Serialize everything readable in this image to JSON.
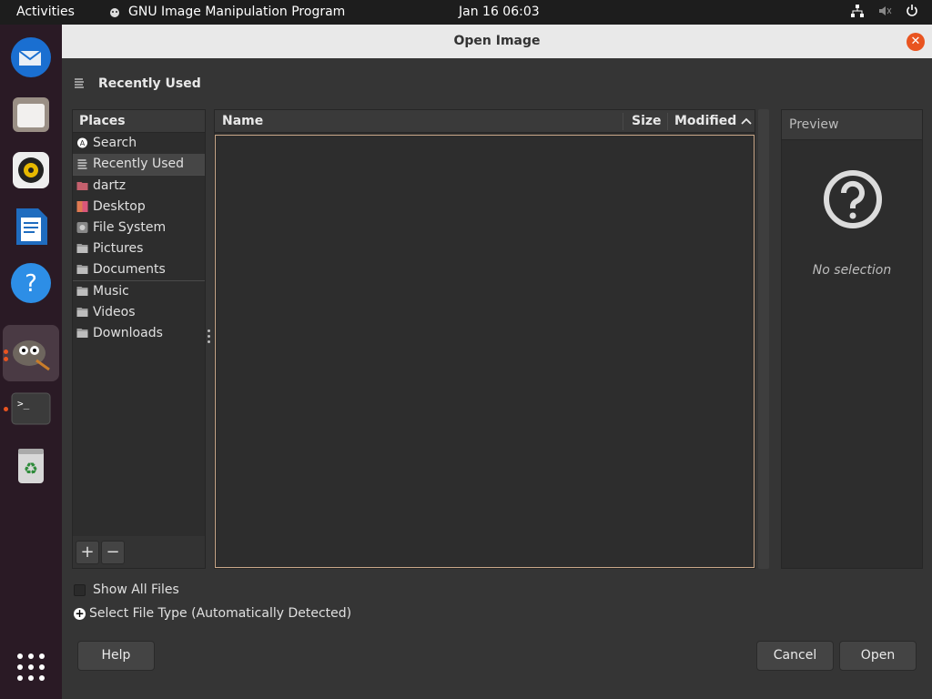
{
  "topbar": {
    "activities": "Activities",
    "app_name": "GNU Image Manipulation Program",
    "clock": "Jan 16  06:03"
  },
  "dock": {
    "items": [
      "thunderbird-icon",
      "files-icon",
      "rhythmbox-icon",
      "libreoffice-writer-icon",
      "help-icon",
      "gimp-icon",
      "terminal-icon",
      "trash-icon",
      "show-apps-icon"
    ]
  },
  "dialog": {
    "title": "Open Image",
    "location": "Recently Used",
    "places_header": "Places",
    "places": [
      {
        "label": "Search",
        "icon": "search-icon"
      },
      {
        "label": "Recently Used",
        "icon": "recent-icon",
        "selected": true
      },
      {
        "label": "dartz",
        "icon": "home-folder-icon"
      },
      {
        "label": "Desktop",
        "icon": "desktop-icon"
      },
      {
        "label": "File System",
        "icon": "drive-icon"
      },
      {
        "label": "Pictures",
        "icon": "folder-icon"
      },
      {
        "label": "Documents",
        "icon": "folder-icon"
      },
      {
        "label": "Music",
        "icon": "folder-icon"
      },
      {
        "label": "Videos",
        "icon": "folder-icon"
      },
      {
        "label": "Downloads",
        "icon": "folder-icon"
      }
    ],
    "columns": {
      "name": "Name",
      "size": "Size",
      "modified": "Modified"
    },
    "preview": {
      "header": "Preview",
      "empty": "No selection"
    },
    "show_all_files": "Show All Files",
    "select_file_type": "Select File Type (Automatically Detected)",
    "buttons": {
      "help": "Help",
      "cancel": "Cancel",
      "open": "Open",
      "add": "+",
      "remove": "−"
    }
  },
  "colors": {
    "accent": "#e95420",
    "dock_bg": "#2a1a25",
    "dialog_bg": "#353535"
  }
}
